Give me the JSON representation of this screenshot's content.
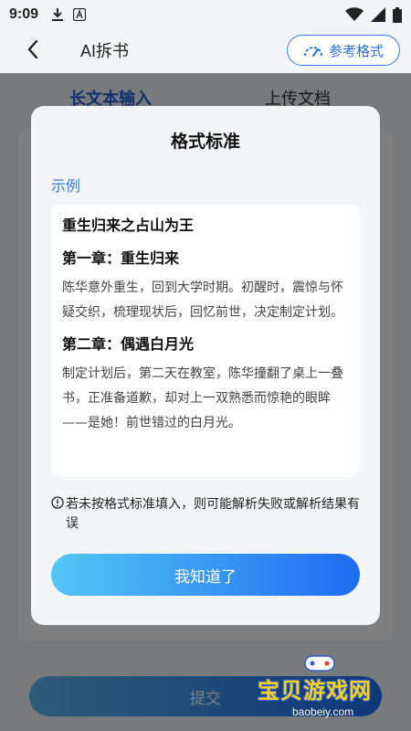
{
  "status_bar": {
    "time": "9:09",
    "icons": [
      "download-icon",
      "a-badge-icon",
      "wifi-icon",
      "signal-icon",
      "battery-icon"
    ]
  },
  "app_bar": {
    "title": "AI拆书",
    "reference_button": "参考格式"
  },
  "tabs": [
    {
      "label": "长文本输入",
      "active": true
    },
    {
      "label": "上传文档",
      "active": false
    }
  ],
  "submit_label": "提交",
  "dialog": {
    "title": "格式标准",
    "example_label": "示例",
    "example": {
      "book_title": "重生归来之占山为王",
      "chapters": [
        {
          "heading": "第一章：重生归来",
          "body": "陈华意外重生，回到大学时期。初醒时，震惊与怀疑交织，梳理现状后，回忆前世，决定制定计划。"
        },
        {
          "heading": "第二章：偶遇白月光",
          "body": "制定计划后，第二天在教室，陈华撞翻了桌上一叠书，正准备道歉，却对上一双熟悉而惊艳的眼眸——是她！前世错过的白月光。"
        }
      ]
    },
    "warning": "若未按格式标准填入，则可能解析失败或解析结果有误",
    "confirm_button": "我知道了"
  },
  "watermark": {
    "text": "宝贝游戏网",
    "url": "baobeiy.com"
  },
  "colors": {
    "accent": "#1f63e0",
    "link": "#2f7be6",
    "gradient_start": "#54c6f4",
    "gradient_end": "#1e6cf0",
    "dialog_bg": "#f3f5f8"
  }
}
